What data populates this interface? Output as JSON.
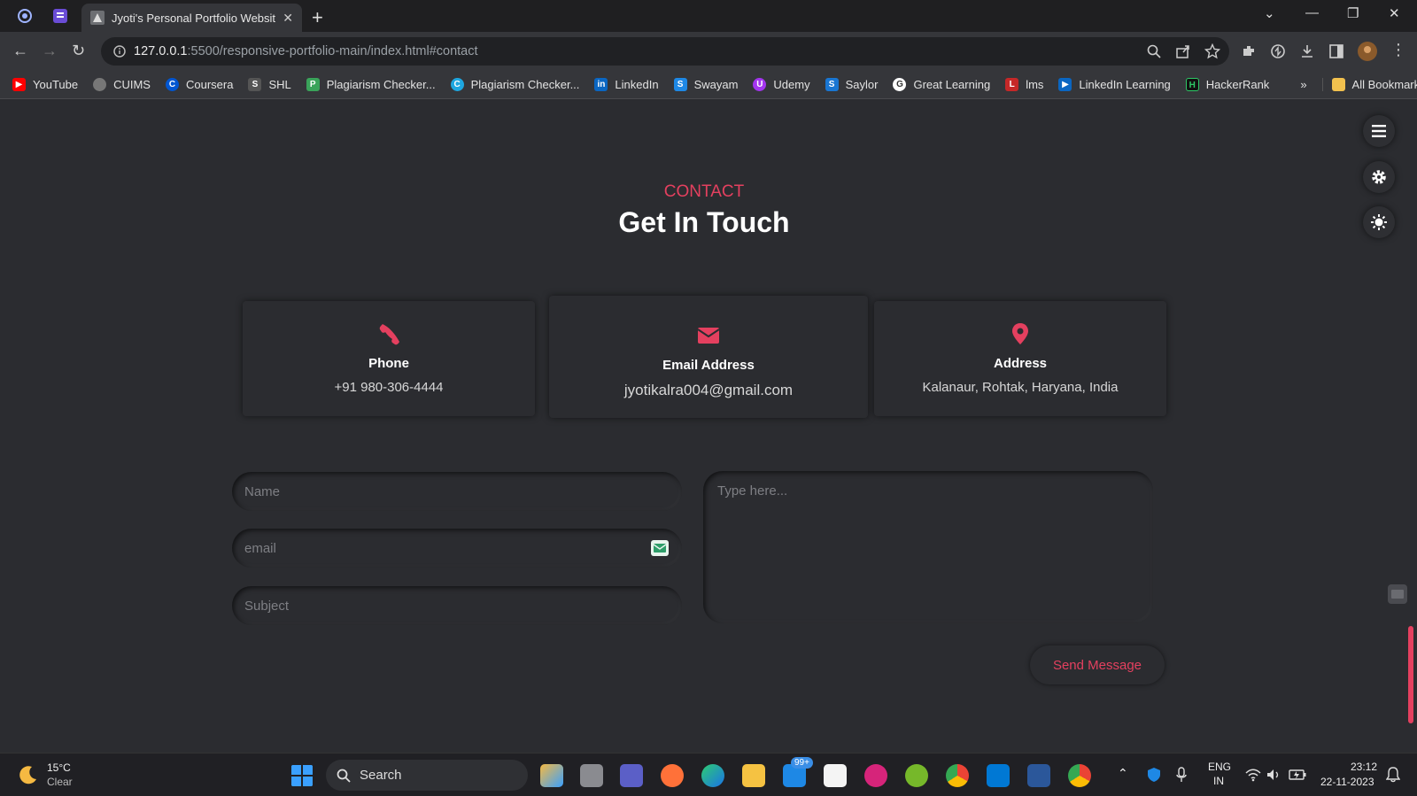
{
  "browser": {
    "tab_title": "Jyoti's Personal Portfolio Websit",
    "url_host": "127.0.0.1",
    "url_path": ":5500/responsive-portfolio-main/index.html#contact",
    "bookmarks": [
      {
        "label": "YouTube",
        "color": "#ff0000"
      },
      {
        "label": "CUIMS",
        "color": "#777777"
      },
      {
        "label": "Coursera",
        "color": "#0056d2"
      },
      {
        "label": "SHL",
        "color": "#555555"
      },
      {
        "label": "Plagiarism Checker...",
        "color": "#3aa35a"
      },
      {
        "label": "Plagiarism Checker...",
        "color": "#1ea7e1"
      },
      {
        "label": "LinkedIn",
        "color": "#0a66c2"
      },
      {
        "label": "Swayam",
        "color": "#1e88e5"
      },
      {
        "label": "Udemy",
        "color": "#a435f0"
      },
      {
        "label": "Saylor",
        "color": "#1976d2"
      },
      {
        "label": "Great Learning",
        "color": "#ffffff"
      },
      {
        "label": "lms",
        "color": "#c62828"
      },
      {
        "label": "LinkedIn Learning",
        "color": "#0a66c2"
      },
      {
        "label": "HackerRank",
        "color": "#111111"
      }
    ],
    "overflow": "»",
    "all_bookmarks": "All Bookmarks"
  },
  "contact": {
    "eyebrow": "CONTACT",
    "title": "Get In Touch",
    "cards": [
      {
        "label": "Phone",
        "value": "+91 980-306-4444",
        "icon": "phone-icon"
      },
      {
        "label": "Email Address",
        "value": "jyotikalra004@gmail.com",
        "icon": "envelope-icon"
      },
      {
        "label": "Address",
        "value": "Kalanaur, Rohtak, Haryana, India",
        "icon": "map-pin-icon"
      }
    ],
    "form": {
      "name_placeholder": "Name",
      "email_placeholder": "email",
      "subject_placeholder": "Subject",
      "message_placeholder": "Type here...",
      "send_label": "Send Message"
    }
  },
  "colors": {
    "accent": "#e4405f",
    "background": "#2b2c30"
  },
  "taskbar": {
    "weather_temp": "15°C",
    "weather_desc": "Clear",
    "search_label": "Search",
    "mail_badge": "99+",
    "lang_top": "ENG",
    "lang_bottom": "IN",
    "time": "23:12",
    "date": "22-11-2023"
  }
}
